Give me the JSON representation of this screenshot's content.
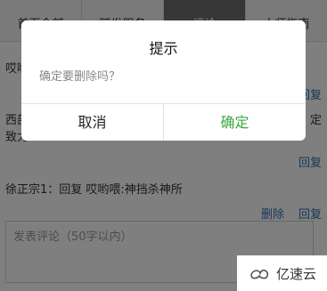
{
  "tabs": [
    {
      "label": "首页全部"
    },
    {
      "label": "踩发服务"
    },
    {
      "label": "评论"
    },
    {
      "label": "大师指南"
    }
  ],
  "comments": [
    {
      "text": "哎哟"
    },
    {
      "text": "西部"
    },
    {
      "text": "致力"
    },
    {
      "text": "徐正宗1：回复 哎哟喂:神挡杀神所"
    }
  ],
  "actions": {
    "reply": "回复",
    "delete": "删除",
    "partial_right": "定"
  },
  "comment_box": {
    "placeholder": "发表评论（50字以内）"
  },
  "dialog": {
    "title": "提示",
    "message": "确定要删除吗？",
    "cancel": "取消",
    "confirm": "确定"
  },
  "watermark": {
    "text": "亿速云"
  }
}
